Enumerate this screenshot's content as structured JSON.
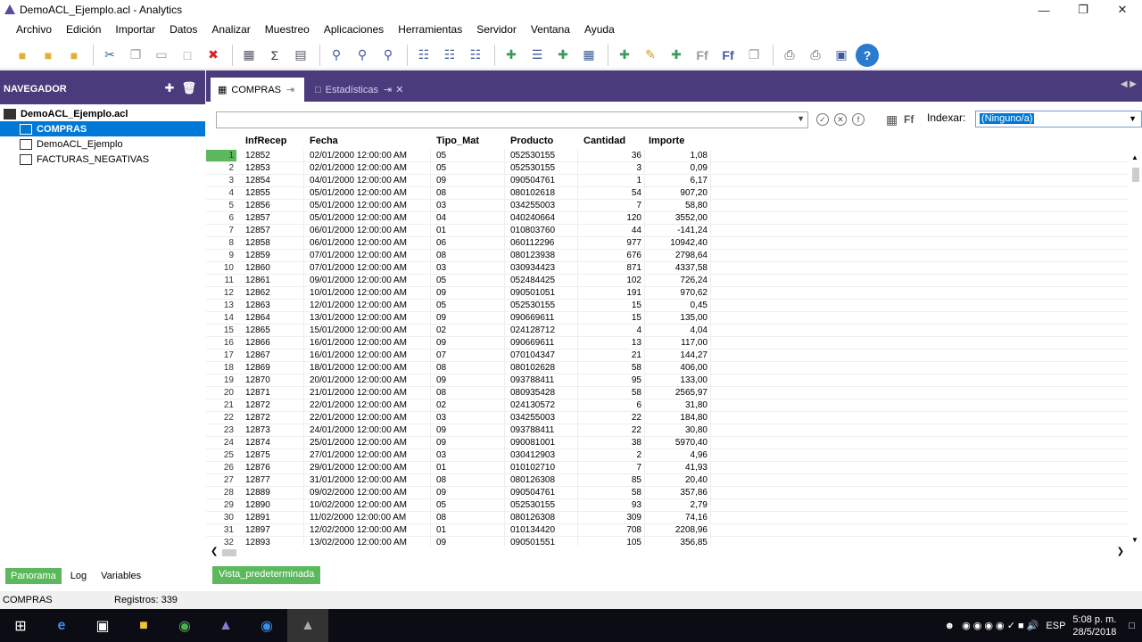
{
  "window": {
    "title": "DemoACL_Ejemplo.acl - Analytics"
  },
  "menu": [
    "Archivo",
    "Edición",
    "Importar",
    "Datos",
    "Analizar",
    "Muestreo",
    "Aplicaciones",
    "Herramientas",
    "Servidor",
    "Ventana",
    "Ayuda"
  ],
  "navigator": {
    "title": "NAVEGADOR",
    "root": "DemoACL_Ejemplo.acl",
    "items": [
      "COMPRAS",
      "DemoACL_Ejemplo",
      "FACTURAS_NEGATIVAS"
    ],
    "bottom_tabs": [
      "Panorama",
      "Log",
      "Variables"
    ]
  },
  "tabs": [
    {
      "label": "COMPRAS"
    },
    {
      "label": "Estadísticas"
    }
  ],
  "filter": {
    "index_label": "Indexar:",
    "index_value": "(Ninguno/a)"
  },
  "table": {
    "columns": [
      "InfRecep",
      "Fecha",
      "Tipo_Mat",
      "Producto",
      "Cantidad",
      "Importe"
    ],
    "rows": [
      [
        "1",
        "12852",
        "02/01/2000 12:00:00 AM",
        "05",
        "052530155",
        "36",
        "1,08"
      ],
      [
        "2",
        "12853",
        "02/01/2000 12:00:00 AM",
        "05",
        "052530155",
        "3",
        "0,09"
      ],
      [
        "3",
        "12854",
        "04/01/2000 12:00:00 AM",
        "09",
        "090504761",
        "1",
        "6,17"
      ],
      [
        "4",
        "12855",
        "05/01/2000 12:00:00 AM",
        "08",
        "080102618",
        "54",
        "907,20"
      ],
      [
        "5",
        "12856",
        "05/01/2000 12:00:00 AM",
        "03",
        "034255003",
        "7",
        "58,80"
      ],
      [
        "6",
        "12857",
        "05/01/2000 12:00:00 AM",
        "04",
        "040240664",
        "120",
        "3552,00"
      ],
      [
        "7",
        "12857",
        "06/01/2000 12:00:00 AM",
        "01",
        "010803760",
        "44",
        "-141,24"
      ],
      [
        "8",
        "12858",
        "06/01/2000 12:00:00 AM",
        "06",
        "060112296",
        "977",
        "10942,40"
      ],
      [
        "9",
        "12859",
        "07/01/2000 12:00:00 AM",
        "08",
        "080123938",
        "676",
        "2798,64"
      ],
      [
        "10",
        "12860",
        "07/01/2000 12:00:00 AM",
        "03",
        "030934423",
        "871",
        "4337,58"
      ],
      [
        "11",
        "12861",
        "09/01/2000 12:00:00 AM",
        "05",
        "052484425",
        "102",
        "726,24"
      ],
      [
        "12",
        "12862",
        "10/01/2000 12:00:00 AM",
        "09",
        "090501051",
        "191",
        "970,62"
      ],
      [
        "13",
        "12863",
        "12/01/2000 12:00:00 AM",
        "05",
        "052530155",
        "15",
        "0,45"
      ],
      [
        "14",
        "12864",
        "13/01/2000 12:00:00 AM",
        "09",
        "090669611",
        "15",
        "135,00"
      ],
      [
        "15",
        "12865",
        "15/01/2000 12:00:00 AM",
        "02",
        "024128712",
        "4",
        "4,04"
      ],
      [
        "16",
        "12866",
        "16/01/2000 12:00:00 AM",
        "09",
        "090669611",
        "13",
        "117,00"
      ],
      [
        "17",
        "12867",
        "16/01/2000 12:00:00 AM",
        "07",
        "070104347",
        "21",
        "144,27"
      ],
      [
        "18",
        "12869",
        "18/01/2000 12:00:00 AM",
        "08",
        "080102628",
        "58",
        "406,00"
      ],
      [
        "19",
        "12870",
        "20/01/2000 12:00:00 AM",
        "09",
        "093788411",
        "95",
        "133,00"
      ],
      [
        "20",
        "12871",
        "21/01/2000 12:00:00 AM",
        "08",
        "080935428",
        "58",
        "2565,97"
      ],
      [
        "21",
        "12872",
        "22/01/2000 12:00:00 AM",
        "02",
        "024130572",
        "6",
        "31,80"
      ],
      [
        "22",
        "12872",
        "22/01/2000 12:00:00 AM",
        "03",
        "034255003",
        "22",
        "184,80"
      ],
      [
        "23",
        "12873",
        "24/01/2000 12:00:00 AM",
        "09",
        "093788411",
        "22",
        "30,80"
      ],
      [
        "24",
        "12874",
        "25/01/2000 12:00:00 AM",
        "09",
        "090081001",
        "38",
        "5970,40"
      ],
      [
        "25",
        "12875",
        "27/01/2000 12:00:00 AM",
        "03",
        "030412903",
        "2",
        "4,96"
      ],
      [
        "26",
        "12876",
        "29/01/2000 12:00:00 AM",
        "01",
        "010102710",
        "7",
        "41,93"
      ],
      [
        "27",
        "12877",
        "31/01/2000 12:00:00 AM",
        "08",
        "080126308",
        "85",
        "20,40"
      ],
      [
        "28",
        "12889",
        "09/02/2000 12:00:00 AM",
        "09",
        "090504761",
        "58",
        "357,86"
      ],
      [
        "29",
        "12890",
        "10/02/2000 12:00:00 AM",
        "05",
        "052530155",
        "93",
        "2,79"
      ],
      [
        "30",
        "12891",
        "11/02/2000 12:00:00 AM",
        "08",
        "080126308",
        "309",
        "74,16"
      ],
      [
        "31",
        "12897",
        "12/02/2000 12:00:00 AM",
        "01",
        "010134420",
        "708",
        "2208,96"
      ],
      [
        "32",
        "12893",
        "13/02/2000 12:00:00 AM",
        "09",
        "090501551",
        "105",
        "356,85"
      ]
    ]
  },
  "view_tab": "Vista_predeterminada",
  "status": {
    "table": "COMPRAS",
    "records": "Registros: 339"
  },
  "clock": {
    "time": "5:08 p. m.",
    "date": "28/5/2018",
    "lang": "ESP"
  }
}
